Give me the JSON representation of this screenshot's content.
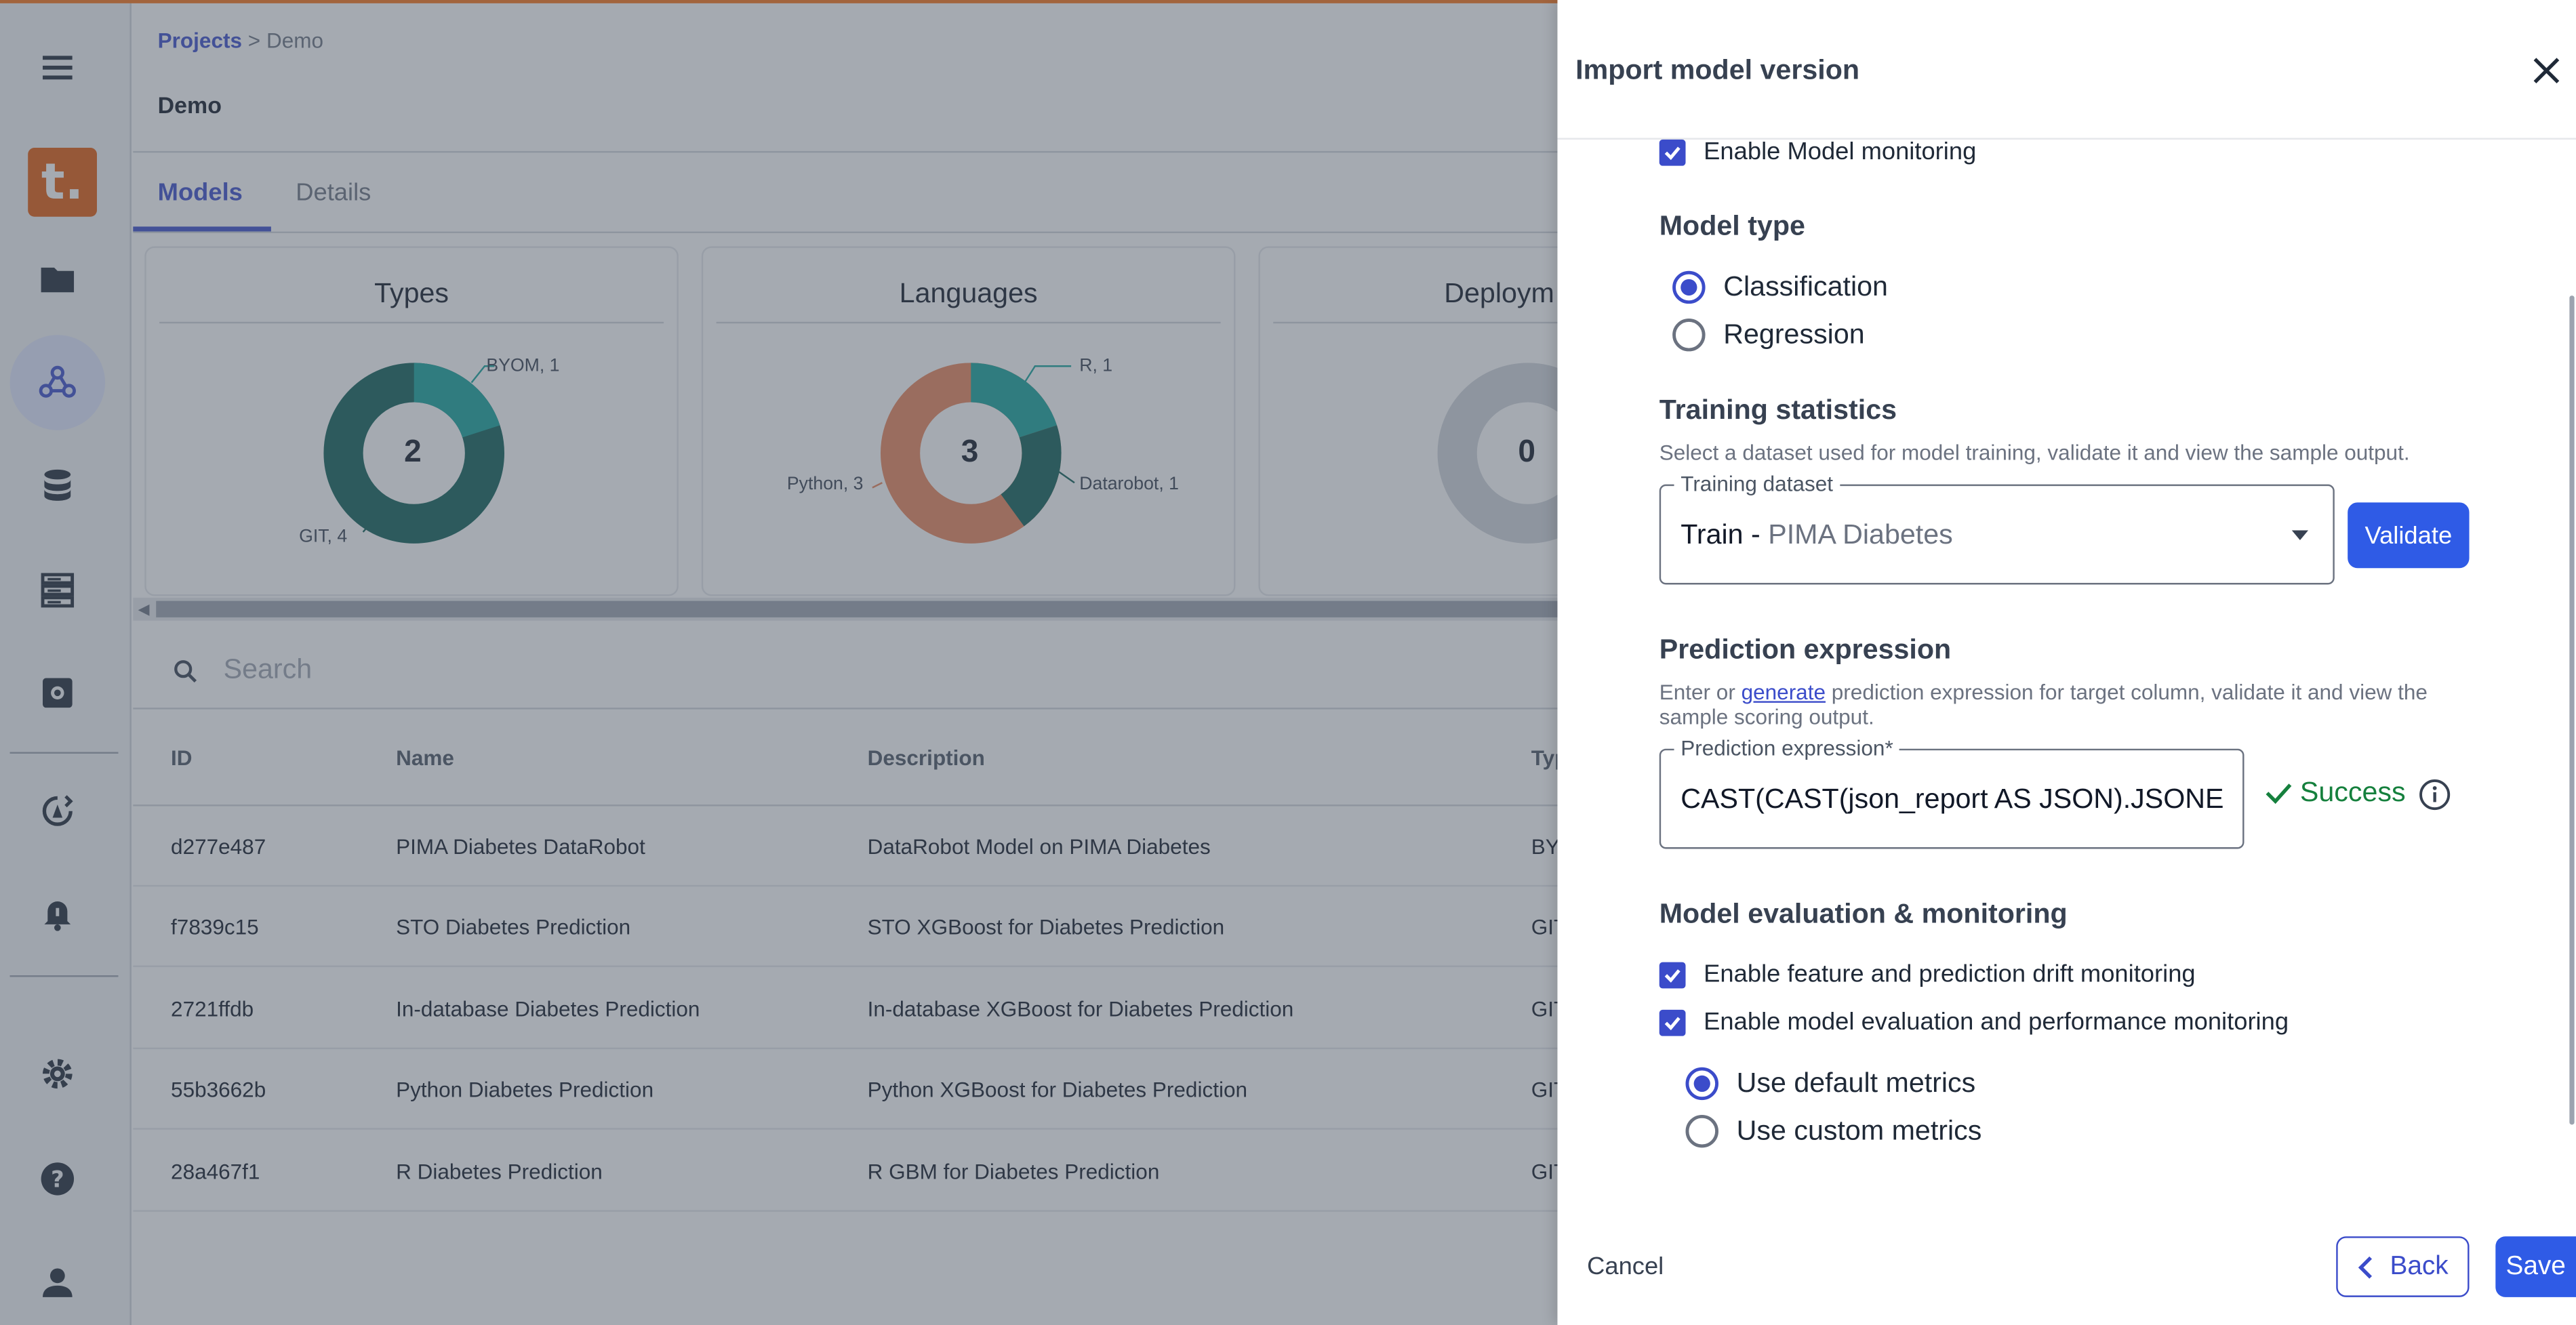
{
  "breadcrumb": {
    "root": "Projects",
    "separator": ">",
    "current": "Demo"
  },
  "page": {
    "title": "Demo"
  },
  "tabs": [
    {
      "label": "Models"
    },
    {
      "label": "Details"
    }
  ],
  "cards": [
    {
      "title": "Types",
      "center": "2",
      "labels": [
        "BYOM, 1",
        "GIT, 4"
      ]
    },
    {
      "title": "Languages",
      "center": "3",
      "labels": [
        "R, 1",
        "Python, 3",
        "Datarobot, 1"
      ]
    },
    {
      "title": "Deploym",
      "center": "0"
    }
  ],
  "search": {
    "placeholder": "Search"
  },
  "table": {
    "headers": [
      "ID",
      "Name",
      "Description",
      "Typ"
    ],
    "rows": [
      {
        "id": "d277e487",
        "name": "PIMA Diabetes DataRobot",
        "description": "DataRobot Model on PIMA Diabetes",
        "type": "BY"
      },
      {
        "id": "f7839c15",
        "name": "STO Diabetes Prediction",
        "description": "STO XGBoost for Diabetes Prediction",
        "type": "GIT"
      },
      {
        "id": "2721ffdb",
        "name": "In-database Diabetes Prediction",
        "description": "In-database XGBoost for Diabetes Prediction",
        "type": "GIT"
      },
      {
        "id": "55b3662b",
        "name": "Python Diabetes Prediction",
        "description": "Python XGBoost for Diabetes Prediction",
        "type": "GIT"
      },
      {
        "id": "28a467f1",
        "name": "R Diabetes Prediction",
        "description": "R GBM for Diabetes Prediction",
        "type": "GIT"
      }
    ]
  },
  "drawer": {
    "title": "Import model version",
    "enable_monitoring": "Enable Model monitoring",
    "model_type": {
      "heading": "Model type",
      "options": [
        "Classification",
        "Regression"
      ],
      "selected": "Classification"
    },
    "training": {
      "heading": "Training statistics",
      "hint": "Select a dataset used for model training, validate it and view the sample output.",
      "field_label": "Training dataset",
      "value_prefix": "Train -",
      "value_name": "PIMA Diabetes",
      "validate_label": "Validate"
    },
    "prediction": {
      "heading": "Prediction expression",
      "hint_before": "Enter or",
      "hint_link": "generate",
      "hint_after": "prediction expression for target column, validate it and view the sample scoring output.",
      "field_label": "Prediction expression*",
      "value": "CAST(CAST(json_report AS JSON).JSONE",
      "status": "Success"
    },
    "evaluation": {
      "heading": "Model evaluation & monitoring",
      "drift": "Enable feature and prediction drift monitoring",
      "performance": "Enable model evaluation and performance monitoring",
      "metrics_options": [
        "Use default metrics",
        "Use custom metrics"
      ],
      "metrics_selected": "Use default metrics"
    },
    "footer": {
      "cancel": "Cancel",
      "back": "Back",
      "save": "Save"
    }
  },
  "colors": {
    "accent": "#3b4cca",
    "primary_button": "#2f5be6",
    "logo": "#e05a0c",
    "success": "#15803d",
    "teal_dark": "#0f5e56",
    "teal": "#14a39a",
    "orange": "#e8855a"
  }
}
